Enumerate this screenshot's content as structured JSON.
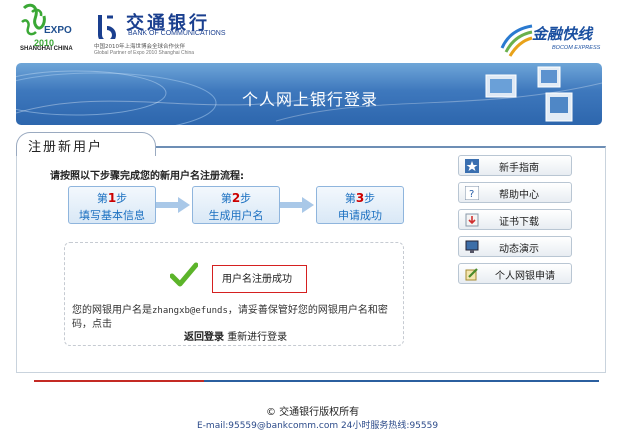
{
  "header": {
    "expo_word": "EXPO",
    "expo_city": "SHANGHAI CHINA",
    "bank_name_cn": "交通银行",
    "bank_name_en": "BANK OF COMMUNICATIONS",
    "partner_cn": "中国2010年上海世博会全球合作伙伴",
    "partner_en": "Global Partner of Expo 2010 Shanghai China",
    "express_cn": "金融快线",
    "express_en": "BOCOM EXPRESS"
  },
  "banner": {
    "title": "个人网上银行登录"
  },
  "panel": {
    "tab_label": "注册新用户",
    "instruction": "请按照以下步骤完成您的新用户名注册流程:",
    "steps": [
      {
        "prefix": "第",
        "num": "1",
        "suffix": "步",
        "label": "填写基本信息"
      },
      {
        "prefix": "第",
        "num": "2",
        "suffix": "步",
        "label": "生成用户名"
      },
      {
        "prefix": "第",
        "num": "3",
        "suffix": "步",
        "label": "申请成功"
      }
    ],
    "success_text": "用户名注册成功",
    "info_prefix": "您的网银用户名是",
    "username": "zhangxb@efunds",
    "info_suffix": "，请妥善保管好您的网银用户名和密码，点击",
    "login_link": "返回登录",
    "reregister_link": "重新进行登录"
  },
  "sidebar": {
    "items": [
      {
        "label": "新手指南",
        "icon": "star-icon"
      },
      {
        "label": "帮助中心",
        "icon": "question-icon"
      },
      {
        "label": "证书下载",
        "icon": "download-icon"
      },
      {
        "label": "动态演示",
        "icon": "monitor-icon"
      },
      {
        "label": "个人网银申请",
        "icon": "pencil-icon"
      }
    ]
  },
  "footer": {
    "copyright": "© 交通银行版权所有",
    "contact": "E-mail:95559@bankcomm.com  24小时服务热线:95559"
  },
  "colors": {
    "brand_blue": "#1a3f8f",
    "step_blue": "#1a6fc0",
    "step_num_red": "#cc0000",
    "footer_red": "#c42a24",
    "footer_blue": "#2b5f9f"
  }
}
